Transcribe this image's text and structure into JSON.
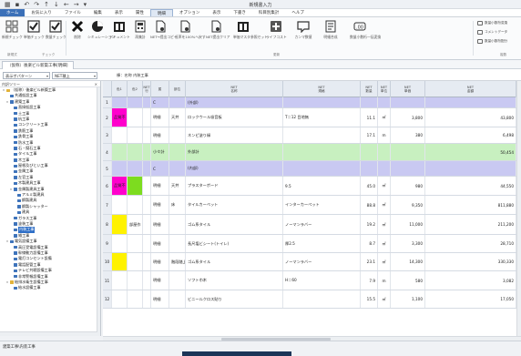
{
  "window": {
    "title": "新規書入力"
  },
  "menu": {
    "items": [
      "ホーム",
      "お気に入り",
      "ファイル",
      "編集",
      "表示",
      "属性",
      "明細",
      "オプション",
      "表示",
      "下書き",
      "科目別集計",
      "ヘルプ"
    ]
  },
  "ribbon": {
    "buttons": [
      {
        "label": "新規チェック",
        "icon": "new-check-icon"
      },
      {
        "label": "単価チェック",
        "icon": "price-check-icon"
      },
      {
        "label": "数量チェック",
        "icon": "quantity-check-icon"
      },
      {
        "label": "削除",
        "icon": "delete-icon"
      },
      {
        "label": "シミュレーション",
        "icon": "simulation-icon"
      },
      {
        "label": "ドキュメント",
        "icon": "document-icon"
      },
      {
        "label": "再集計",
        "icon": "recalc-icon"
      },
      {
        "label": "NET→提出コピー",
        "icon": "copy-icon"
      },
      {
        "label": "低率を100%へ戻す",
        "icon": "reset-rate-icon"
      },
      {
        "label": "NET提出クリア",
        "icon": "clear-icon"
      },
      {
        "label": "単価マスタ参照セット",
        "icon": "master-icon"
      },
      {
        "label": "ライフコスト",
        "icon": "lifecost-icon"
      },
      {
        "label": "カンマ数値",
        "icon": "comma-icon"
      },
      {
        "label": "明細合成",
        "icon": "merge-icon"
      },
      {
        "label": "数量小数桁一括変換",
        "icon": "decimal-icon"
      }
    ],
    "side_items": [
      "数量小数桁変換",
      "コメントデータ",
      "数量小数桁配分"
    ],
    "groups": [
      "新規式",
      "チェック",
      "更新",
      "複数"
    ]
  },
  "doc_tab": {
    "label": "（仮称）後楽ビル新築工事[明細]"
  },
  "toolbar2": {
    "pattern_label": "表示ポパターン",
    "pattern_value": "NET積上",
    "name_field": "棟：名称 内装工事"
  },
  "tree": {
    "header": "内訳ツリー",
    "nodes": [
      {
        "label": "（仮称）後楽ビル新築工事",
        "level": 0,
        "toggle": "▾",
        "color": "y"
      },
      {
        "label": "共通仮設工事",
        "level": 1,
        "toggle": "",
        "color": "b"
      },
      {
        "label": "建築工事",
        "level": 1,
        "toggle": "▾",
        "color": "b"
      },
      {
        "label": "直接仮設工事",
        "level": 2,
        "toggle": "",
        "color": "b"
      },
      {
        "label": "土工事",
        "level": 2,
        "toggle": "",
        "color": "b"
      },
      {
        "label": "杭工事",
        "level": 2,
        "toggle": "",
        "color": "b"
      },
      {
        "label": "コンクリート工事",
        "level": 2,
        "toggle": "",
        "color": "b"
      },
      {
        "label": "鉄筋工事",
        "level": 2,
        "toggle": "",
        "color": "b"
      },
      {
        "label": "鉄骨工事",
        "level": 2,
        "toggle": "",
        "color": "b"
      },
      {
        "label": "防水工事",
        "level": 2,
        "toggle": "",
        "color": "b"
      },
      {
        "label": "石・擬石工事",
        "level": 2,
        "toggle": "",
        "color": "b"
      },
      {
        "label": "タイル工事",
        "level": 2,
        "toggle": "",
        "color": "b"
      },
      {
        "label": "木工事",
        "level": 2,
        "toggle": "",
        "color": "b"
      },
      {
        "label": "屋根及びとい工事",
        "level": 2,
        "toggle": "",
        "color": "b"
      },
      {
        "label": "金属工事",
        "level": 2,
        "toggle": "",
        "color": "b"
      },
      {
        "label": "左官工事",
        "level": 2,
        "toggle": "",
        "color": "b"
      },
      {
        "label": "木製建具工事",
        "level": 2,
        "toggle": "",
        "color": "b"
      },
      {
        "label": "金属製建具工事",
        "level": 2,
        "toggle": "▾",
        "color": "b"
      },
      {
        "label": "アルミ製建具",
        "level": 3,
        "toggle": "",
        "color": "b"
      },
      {
        "label": "鋼製建具",
        "level": 3,
        "toggle": "",
        "color": "b"
      },
      {
        "label": "鋼製シャッター",
        "level": 3,
        "toggle": "",
        "color": "b"
      },
      {
        "label": "建具",
        "level": 3,
        "toggle": "",
        "color": "b"
      },
      {
        "label": "ガラス工事",
        "level": 2,
        "toggle": "",
        "color": "b"
      },
      {
        "label": "塗装工事",
        "level": 2,
        "toggle": "",
        "color": "b"
      },
      {
        "label": "内装工事",
        "level": 2,
        "toggle": "",
        "color": "b",
        "selected": true
      },
      {
        "label": "雑工事",
        "level": 2,
        "toggle": "",
        "color": "b"
      },
      {
        "label": "電気設備工事",
        "level": 1,
        "toggle": "▾",
        "color": "b"
      },
      {
        "label": "高圧受電設備工事",
        "level": 2,
        "toggle": "",
        "color": "b"
      },
      {
        "label": "幹線動力設備工事",
        "level": 2,
        "toggle": "",
        "color": "b"
      },
      {
        "label": "電灯コンセント設備",
        "level": 2,
        "toggle": "",
        "color": "b"
      },
      {
        "label": "電話配管工事",
        "level": 2,
        "toggle": "",
        "color": "b"
      },
      {
        "label": "テレビ共聴設備工事",
        "level": 2,
        "toggle": "",
        "color": "b"
      },
      {
        "label": "非常警報設備工事",
        "level": 2,
        "toggle": "",
        "color": "b"
      },
      {
        "label": "給排水衛生設備工事",
        "level": 1,
        "toggle": "▾",
        "color": "y"
      },
      {
        "label": "給水設備工事",
        "level": 2,
        "toggle": "",
        "color": "b"
      }
    ]
  },
  "grid": {
    "headers": [
      "",
      "色1",
      "色2",
      "NET\n行",
      "属",
      "部位",
      "NET\n名称",
      "NET\n規格",
      "NET\n数量",
      "NET\n単位",
      "NET\n単価",
      "NET\n金額"
    ],
    "rows": [
      {
        "no": "1",
        "c1": "",
        "c2": "",
        "ntype": "",
        "zoku": "C",
        "bui": "",
        "name": "(外部)",
        "spec": "",
        "qty": "",
        "unit": "",
        "price": "",
        "amount": "",
        "bg": "#c9c9f2"
      },
      {
        "no": "2",
        "c1": "#ff00cc",
        "c1t": "品質不",
        "c2": "",
        "ntype": "",
        "zoku": "明細",
        "bui": "天井",
        "name": "ロックウール吸音板",
        "spec": "T＝12 目地無",
        "qty": "11.1",
        "unit": "㎡",
        "price": "3,800",
        "amount": "43,800",
        "bg": ""
      },
      {
        "no": "3",
        "c1": "",
        "c2": "",
        "ntype": "",
        "zoku": "明細",
        "bui": "",
        "name": "ネンピ塗り縁",
        "spec": "",
        "qty": "17.1",
        "unit": "m",
        "price": "380",
        "amount": "6,498",
        "bg": ""
      },
      {
        "no": "4",
        "c1": "",
        "c2": "",
        "ntype": "",
        "zoku": "小々計",
        "bui": "",
        "name": "外部計",
        "spec": "",
        "qty": "",
        "unit": "",
        "price": "",
        "amount": "50,454",
        "bg": "#c8f0c0"
      },
      {
        "no": "5",
        "c1": "",
        "c2": "",
        "ntype": "",
        "zoku": "C",
        "bui": "",
        "name": "(内部)",
        "spec": "",
        "qty": "",
        "unit": "",
        "price": "",
        "amount": "",
        "bg": "#c9c9f2"
      },
      {
        "no": "6",
        "c1": "#ff00cc",
        "c1t": "品質不",
        "c2": "#7ddc1f",
        "ntype": "",
        "zoku": "明細",
        "bui": "天井",
        "name": "プラスターボード",
        "spec": "9.5",
        "qty": "45.0",
        "unit": "㎡",
        "price": "980",
        "amount": "44,550",
        "bg": ""
      },
      {
        "no": "7",
        "c1": "",
        "c2": "",
        "ntype": "",
        "zoku": "明細",
        "bui": "床",
        "name": "タイルカーペット",
        "spec": "インターカーペット",
        "qty": "88.8",
        "unit": "㎡",
        "price": "9,350",
        "amount": "811,880",
        "bg": ""
      },
      {
        "no": "8",
        "c1": "#fff200",
        "c1t": "",
        "c2": "",
        "c2t": "部屋作",
        "ntype": "",
        "zoku": "明細",
        "bui": "",
        "name": "ゴム系タイル",
        "spec": "ノーマンラバー",
        "qty": "19.2",
        "unit": "㎡",
        "price": "11,000",
        "amount": "211,200",
        "bg": ""
      },
      {
        "no": "9",
        "c1": "",
        "c2": "",
        "ntype": "",
        "zoku": "明細",
        "bui": "",
        "name": "長尺塩ビシート(トイレ)",
        "spec": "厚2.5",
        "qty": "8.7",
        "unit": "㎡",
        "price": "3,300",
        "amount": "28,710",
        "bg": ""
      },
      {
        "no": "10",
        "c1": "#fff200",
        "c1t": "",
        "c2": "",
        "ntype": "",
        "zoku": "明細",
        "bui": "階段踏上",
        "name": "ゴム系タイル",
        "spec": "ノーマンラバー",
        "qty": "23.1",
        "unit": "㎡",
        "price": "14,300",
        "amount": "330,330",
        "bg": ""
      },
      {
        "no": "11",
        "c1": "",
        "c2": "",
        "ntype": "",
        "zoku": "明細",
        "bui": "",
        "name": "ソフト巾木",
        "spec": "H＝60",
        "qty": "7.9",
        "unit": "m",
        "price": "580",
        "amount": "3,082",
        "bg": ""
      },
      {
        "no": "12",
        "c1": "",
        "c2": "",
        "ntype": "",
        "zoku": "明細",
        "bui": "",
        "name": "ビニールクロス貼り",
        "spec": "",
        "qty": "15.5",
        "unit": "㎡",
        "price": "1,100",
        "amount": "17,050",
        "bg": ""
      }
    ]
  },
  "status": {
    "text": "建築工事\\内装工事"
  }
}
